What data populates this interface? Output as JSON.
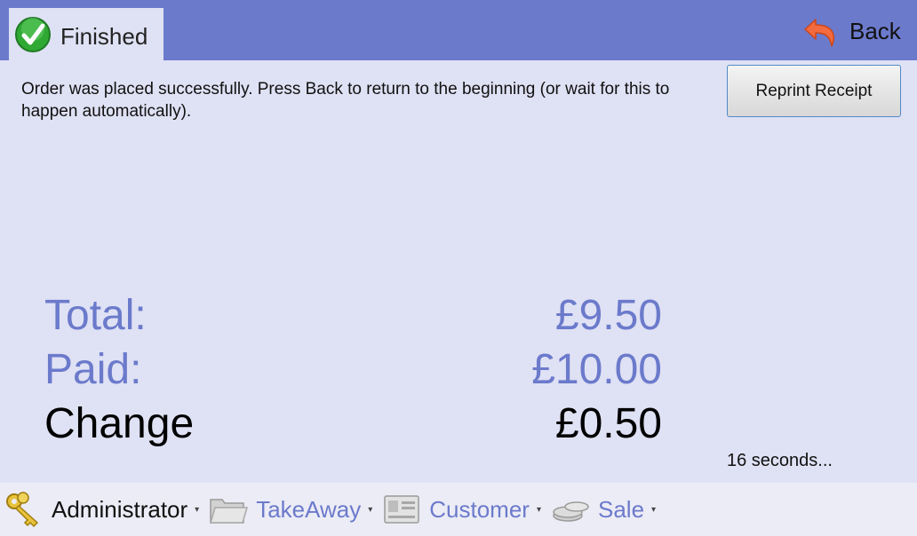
{
  "header": {
    "tab_label": "Finished",
    "back_label": "Back"
  },
  "message": "Order was placed successfully. Press Back to return to the beginning (or wait for this to happen automatically).",
  "reprint_label": "Reprint Receipt",
  "summary": {
    "total_label": "Total:",
    "total_value": "£9.50",
    "paid_label": "Paid:",
    "paid_value": "£10.00",
    "change_label": "Change",
    "change_value": "£0.50"
  },
  "countdown": "16 seconds...",
  "footer": {
    "items": [
      {
        "label": "Administrator",
        "icon": "key-icon",
        "active": true
      },
      {
        "label": "TakeAway",
        "icon": "folder-icon",
        "active": false
      },
      {
        "label": "Customer",
        "icon": "contact-card-icon",
        "active": false
      },
      {
        "label": "Sale",
        "icon": "coins-icon",
        "active": false
      }
    ]
  },
  "colors": {
    "accent": "#6b7acb",
    "background": "#dfe1f4",
    "success": "#34b437"
  }
}
